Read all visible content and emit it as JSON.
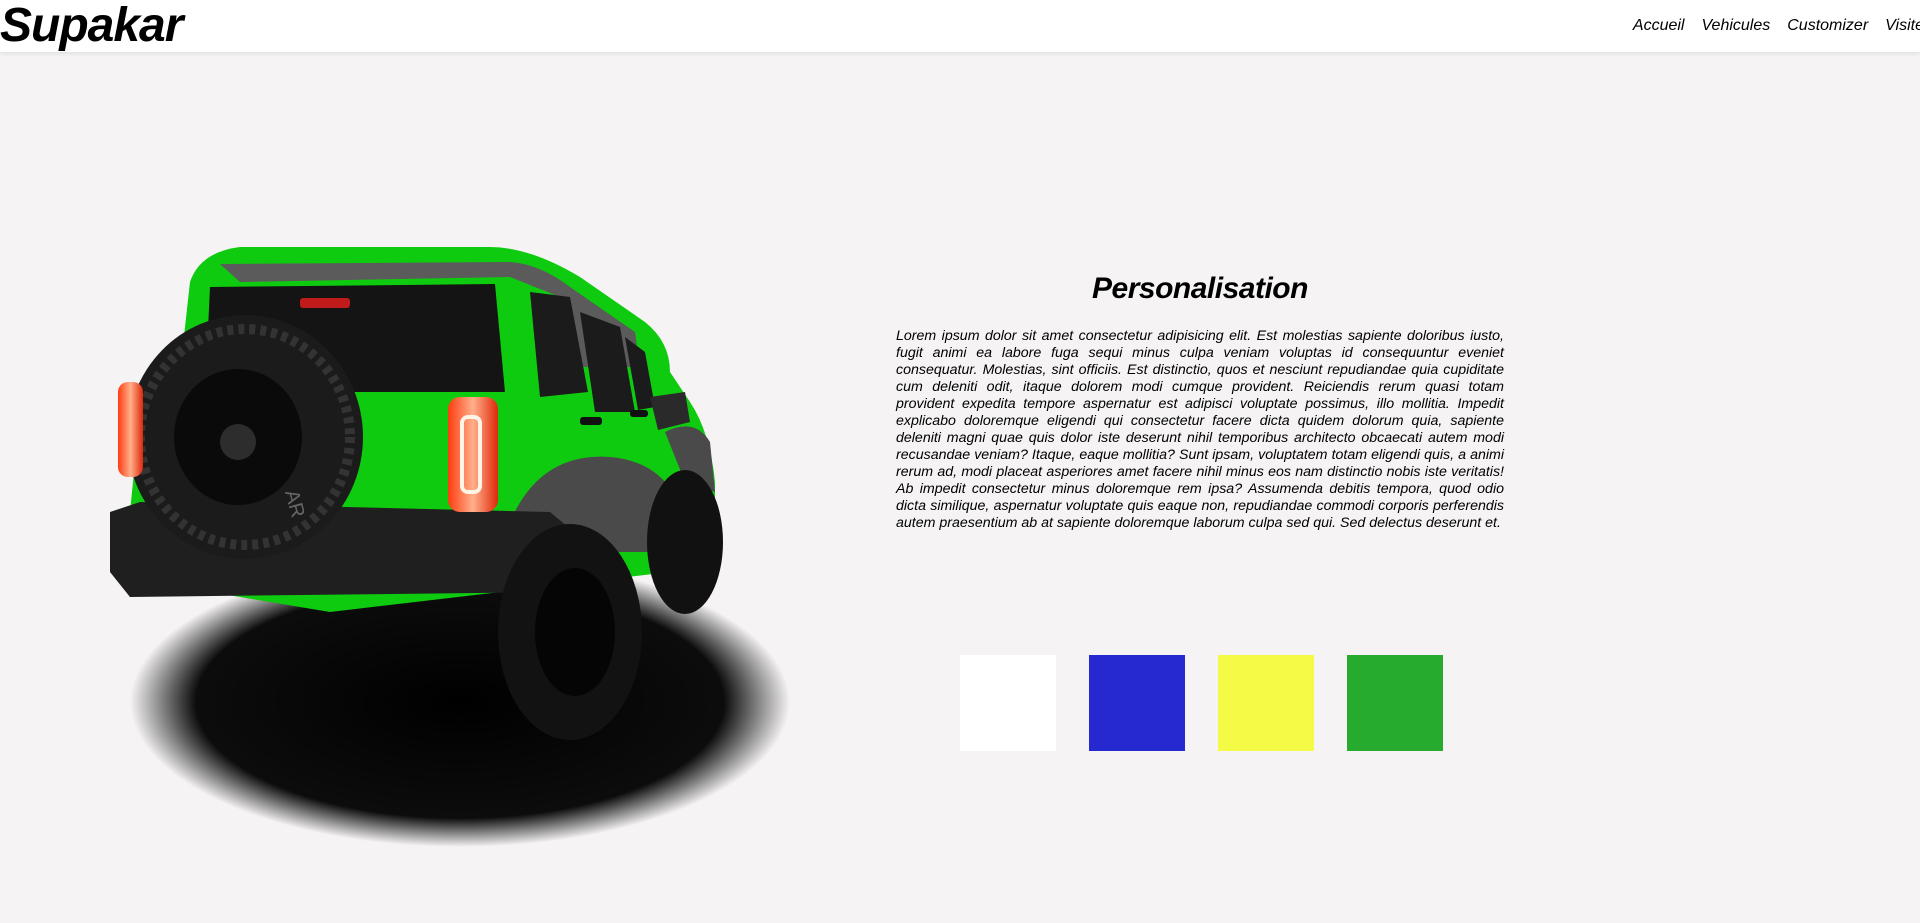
{
  "brand": {
    "name": "Supakar"
  },
  "nav": {
    "items": [
      {
        "label": "Accueil"
      },
      {
        "label": "Vehicules"
      },
      {
        "label": "Customizer"
      },
      {
        "label": "Visite"
      }
    ]
  },
  "customizer": {
    "title": "Personalisation",
    "description": "Lorem ipsum dolor sit amet consectetur adipisicing elit. Est molestias sapiente doloribus iusto, fugit animi ea labore fuga sequi minus culpa veniam voluptas id consequuntur eveniet consequatur. Molestias, sint officiis. Est distinctio, quos et nesciunt repudiandae quia cupiditate cum deleniti odit, itaque dolorem modi cumque provident. Reiciendis rerum quasi totam provident expedita tempore aspernatur est adipisci voluptate possimus, illo mollitia. Impedit explicabo doloremque eligendi qui consectetur facere dicta quidem dolorum quia, sapiente deleniti magni quae quis dolor iste deserunt nihil temporibus architecto obcaecati autem modi recusandae veniam? Itaque, eaque mollitia? Sunt ipsam, voluptatem totam eligendi quis, a animi rerum ad, modi placeat asperiores amet facere nihil minus eos nam distinctio nobis iste veritatis! Ab impedit consectetur minus doloremque rem ipsa? Assumenda debitis tempora, quod odio dicta similique, aspernatur voluptate quis eaque non, repudiandae commodi corporis perferendis autem praesentium ab at sapiente doloremque laborum culpa sed qui. Sed delectus deserunt et.",
    "colors": {
      "white": "#ffffff",
      "blue": "#2629cf",
      "yellow": "#f4fa45",
      "green": "#26ab2f"
    },
    "car": {
      "body_color": "#0fcb0f",
      "tire_text": "AR"
    }
  }
}
